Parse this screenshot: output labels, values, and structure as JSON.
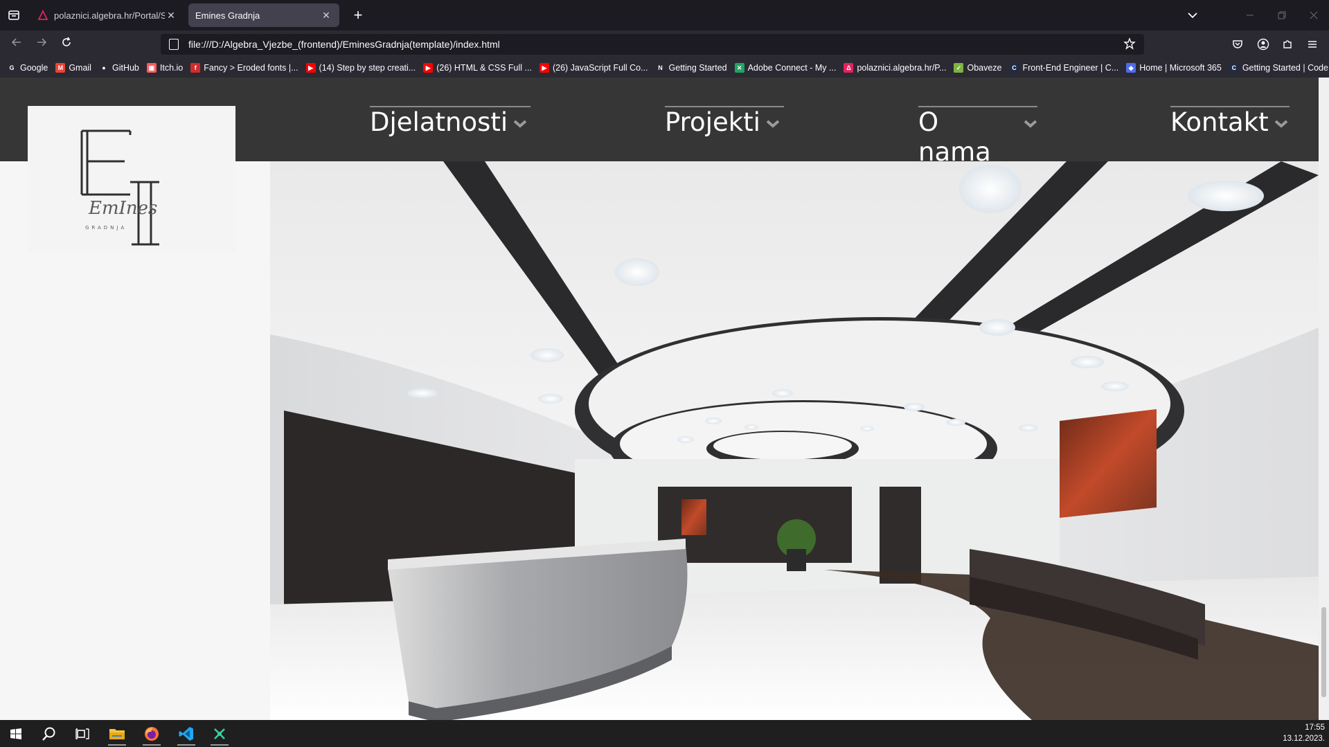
{
  "browser": {
    "tabs": [
      {
        "title": "polaznici.algebra.hr/Portal/Sec...",
        "active": false
      },
      {
        "title": "Emines Gradnja",
        "active": true
      }
    ],
    "new_tab_label": "+",
    "url": "file:///D:/Algebra_Vjezbe_(frontend)/EminesGradnja(template)/index.html",
    "bookmarks": [
      {
        "label": "Google",
        "icon": "google-icon",
        "color": "#ffffff"
      },
      {
        "label": "Gmail",
        "icon": "gmail-icon",
        "color": "#ea4335"
      },
      {
        "label": "GitHub",
        "icon": "github-icon",
        "color": "#ffffff"
      },
      {
        "label": "Itch.io",
        "icon": "itchio-icon",
        "color": "#fa5c5c"
      },
      {
        "label": "Fancy > Eroded fonts |...",
        "icon": "dafont-icon",
        "color": "#d32b2b"
      },
      {
        "label": "(14) Step by step creati...",
        "icon": "youtube-icon",
        "color": "#ff0000"
      },
      {
        "label": "(26) HTML & CSS Full ...",
        "icon": "youtube-icon",
        "color": "#ff0000"
      },
      {
        "label": "(26) JavaScript Full Co...",
        "icon": "youtube-icon",
        "color": "#ff0000"
      },
      {
        "label": "Getting Started",
        "icon": "notion-icon",
        "color": "#ffffff"
      },
      {
        "label": "Adobe Connect - My ...",
        "icon": "adobe-connect-icon",
        "color": "#1fa463"
      },
      {
        "label": "polaznici.algebra.hr/P...",
        "icon": "algebra-icon",
        "color": "#e0245e"
      },
      {
        "label": "Obaveze",
        "icon": "obaveze-icon",
        "color": "#7cb342"
      },
      {
        "label": "Front-End Engineer | C...",
        "icon": "codecademy-icon",
        "color": "#1f2a44"
      },
      {
        "label": "Home | Microsoft 365",
        "icon": "microsoft365-icon",
        "color": "#4f6bed"
      },
      {
        "label": "Getting Started | Code...",
        "icon": "codecademy-icon",
        "color": "#1f2a44"
      }
    ]
  },
  "site": {
    "logo_script": "EmInes",
    "logo_sub": "GRADNJA",
    "nav": [
      {
        "label": "Djelatnosti"
      },
      {
        "label": "Projekti"
      },
      {
        "label": "O nama"
      },
      {
        "label": "Kontakt"
      }
    ],
    "hero_description": "",
    "colors": {
      "header": "#363636",
      "page_bg": "#f6f6f6",
      "nav_text": "#ffffff"
    }
  },
  "taskbar": {
    "apps": [
      "windows-start-icon",
      "search-icon",
      "task-view-icon",
      "file-explorer-icon",
      "firefox-icon",
      "vscode-icon",
      "git-kraken-icon"
    ],
    "time": "17:55",
    "date": "13.12.2023."
  }
}
